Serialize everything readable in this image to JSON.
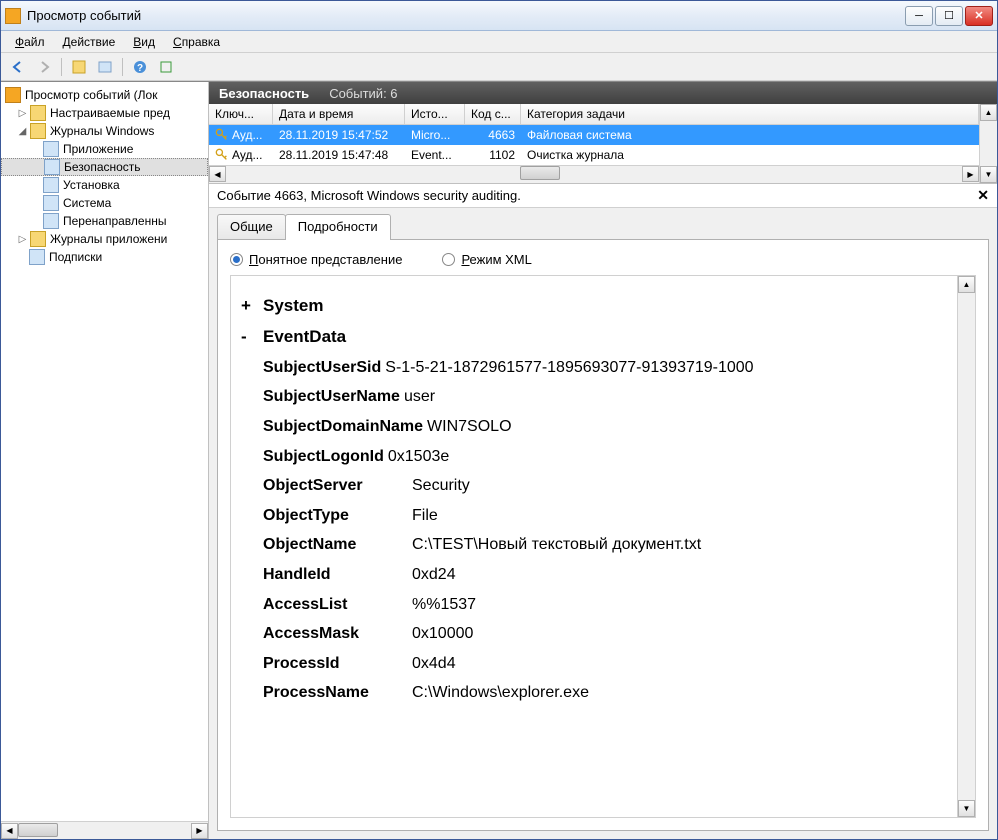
{
  "window": {
    "title": "Просмотр событий"
  },
  "menu": {
    "file": "айл",
    "action": "ействие",
    "view": "ид",
    "help": "правка",
    "file_u": "Ф",
    "action_u": "Д",
    "view_u": "В",
    "help_u": "С"
  },
  "tree": {
    "root": "Просмотр событий (Лок",
    "custom": "Настраиваемые пред",
    "winlogs": "Журналы Windows",
    "app": "Приложение",
    "security": "Безопасность",
    "setup": "Установка",
    "system": "Система",
    "forwarded": "Перенаправленны",
    "appservices": "Журналы приложени",
    "subs": "Подписки"
  },
  "panel": {
    "title": "Безопасность",
    "count": "Событий: 6"
  },
  "list": {
    "cols": {
      "key": "Ключ...",
      "date": "Дата и время",
      "source": "Исто...",
      "code": "Код с...",
      "category": "Категория задачи"
    },
    "rows": [
      {
        "key": "Ауд...",
        "date": "28.11.2019 15:47:52",
        "source": "Micro...",
        "code": "4663",
        "category": "Файловая система"
      },
      {
        "key": "Ауд...",
        "date": "28.11.2019 15:47:48",
        "source": "Event...",
        "code": "1102",
        "category": "Очистка журнала"
      }
    ]
  },
  "detail": {
    "header": "Событие 4663, Microsoft Windows security auditing."
  },
  "tabs": {
    "general": "Общие",
    "details": "Подробности"
  },
  "radio": {
    "friendly": "онятное представление",
    "friendly_u": "П",
    "xml": "ежим XML",
    "xml_u": "Р"
  },
  "event": {
    "system_label": "System",
    "data_label": "EventData",
    "fields": [
      {
        "k": "SubjectUserSid",
        "v": "S-1-5-21-1872961577-1895693077-91393719-1000"
      },
      {
        "k": "SubjectUserName",
        "v": "user"
      },
      {
        "k": "SubjectDomainName",
        "v": "WIN7SOLO"
      },
      {
        "k": "SubjectLogonId",
        "v": "0x1503e"
      },
      {
        "k": "ObjectServer",
        "v": "Security"
      },
      {
        "k": "ObjectType",
        "v": "File"
      },
      {
        "k": "ObjectName",
        "v": "C:\\TEST\\Новый текстовый документ.txt"
      },
      {
        "k": "HandleId",
        "v": "0xd24"
      },
      {
        "k": "AccessList",
        "v": "%%1537"
      },
      {
        "k": "AccessMask",
        "v": "0x10000"
      },
      {
        "k": "ProcessId",
        "v": "0x4d4"
      },
      {
        "k": "ProcessName",
        "v": "C:\\Windows\\explorer.exe"
      }
    ]
  }
}
